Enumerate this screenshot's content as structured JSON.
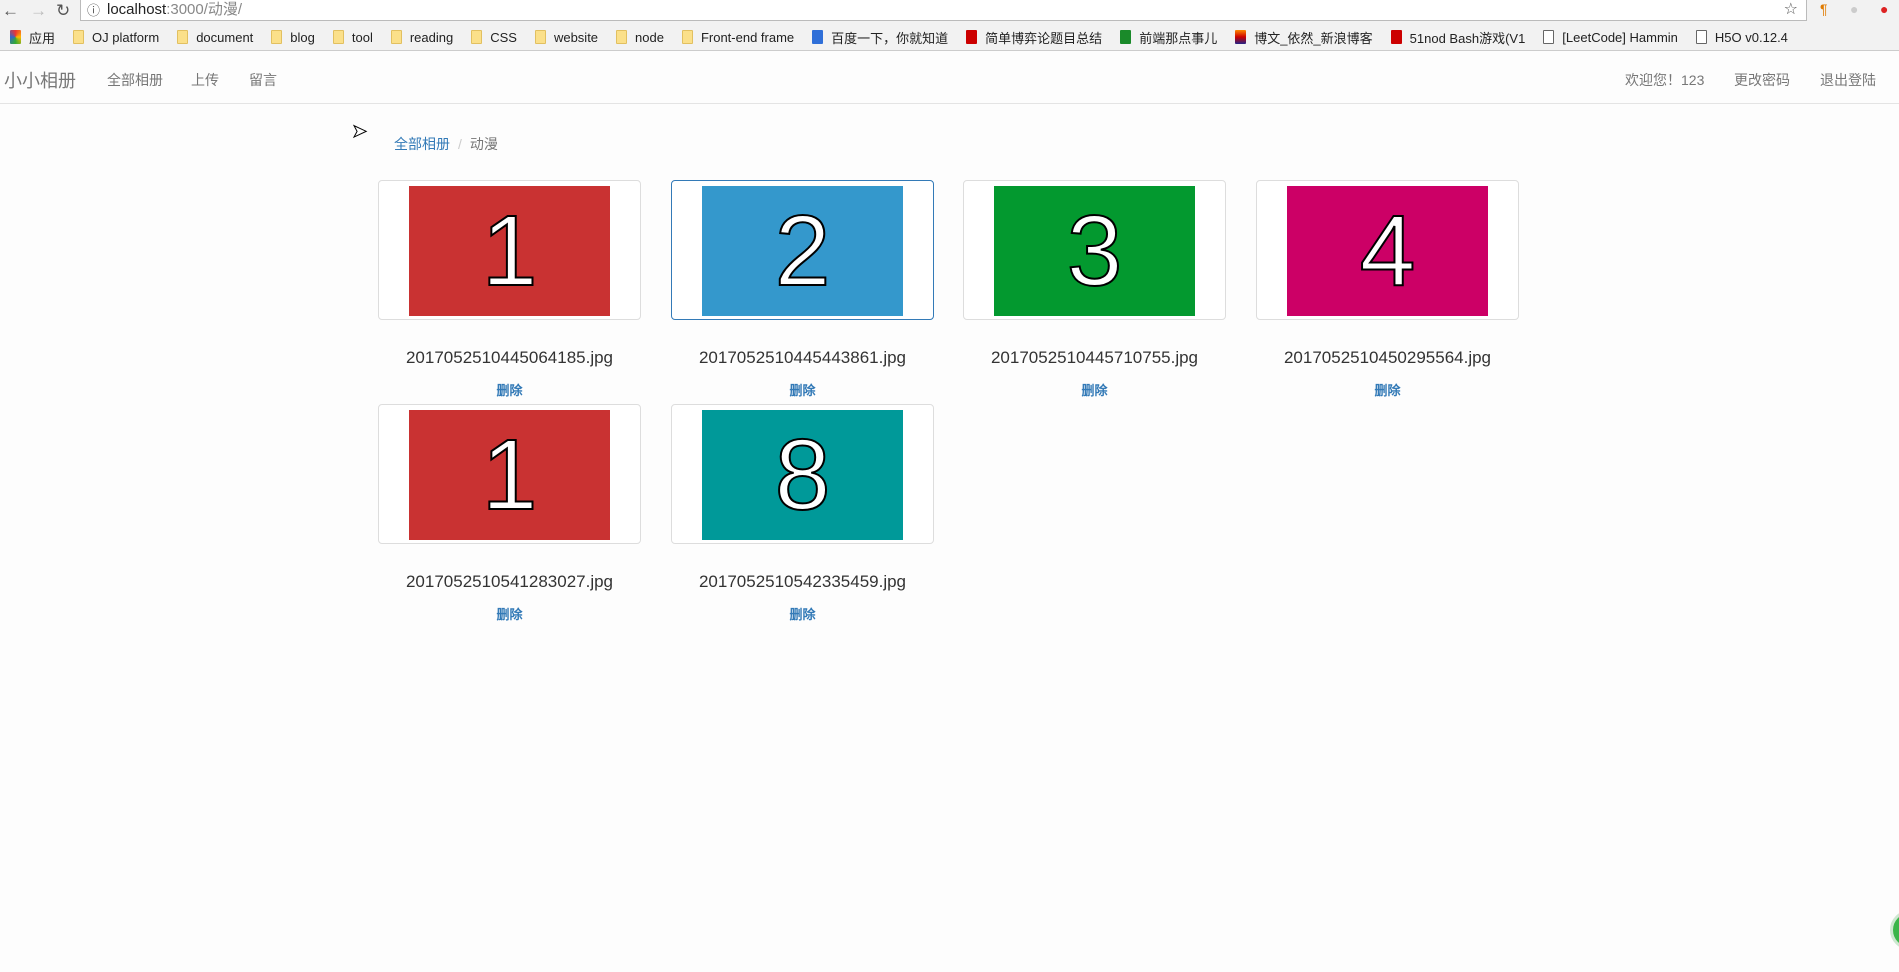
{
  "browser": {
    "url_host": "localhost",
    "url_rest": ":3000/动漫/",
    "bookmarks": [
      {
        "label": "应用",
        "icon": "apps-icon"
      },
      {
        "label": "OJ platform",
        "icon": "folder-icon"
      },
      {
        "label": "document",
        "icon": "folder-icon"
      },
      {
        "label": "blog",
        "icon": "folder-icon"
      },
      {
        "label": "tool",
        "icon": "folder-icon"
      },
      {
        "label": "reading",
        "icon": "folder-icon"
      },
      {
        "label": "CSS",
        "icon": "folder-icon"
      },
      {
        "label": "website",
        "icon": "folder-icon"
      },
      {
        "label": "node",
        "icon": "folder-icon"
      },
      {
        "label": "Front-end frame",
        "icon": "folder-icon"
      },
      {
        "label": "百度一下，你就知道",
        "icon": "baidu-icon"
      },
      {
        "label": "简单博弈论题目总结",
        "icon": "csdn-icon"
      },
      {
        "label": "前端那点事儿",
        "icon": "site-icon"
      },
      {
        "label": "博文_依然_新浪博客",
        "icon": "sina-icon"
      },
      {
        "label": "51nod Bash游戏(V1",
        "icon": "csdn-icon"
      },
      {
        "label": "[LeetCode] Hammin",
        "icon": "leetcode-icon"
      },
      {
        "label": "H5O v0.12.4",
        "icon": "page-icon"
      }
    ]
  },
  "navbar": {
    "brand": "小小相册",
    "links": [
      "全部相册",
      "上传",
      "留言"
    ],
    "welcome": "欢迎您！123",
    "change_password": "更改密码",
    "logout": "退出登陆"
  },
  "breadcrumb": {
    "root": "全部相册",
    "separator": "/",
    "current": "动漫"
  },
  "photos": [
    {
      "number": "1",
      "filename": "2017052510445064185.jpg",
      "color": "#c93232"
    },
    {
      "number": "2",
      "filename": "2017052510445443861.jpg",
      "color": "#3498cc"
    },
    {
      "number": "3",
      "filename": "2017052510445710755.jpg",
      "color": "#03992f"
    },
    {
      "number": "4",
      "filename": "2017052510450295564.jpg",
      "color": "#cc0066"
    },
    {
      "number": "1",
      "filename": "2017052510541283027.jpg",
      "color": "#c93232"
    },
    {
      "number": "8",
      "filename": "2017052510542335459.jpg",
      "color": "#009999"
    }
  ],
  "delete_label": "删除"
}
